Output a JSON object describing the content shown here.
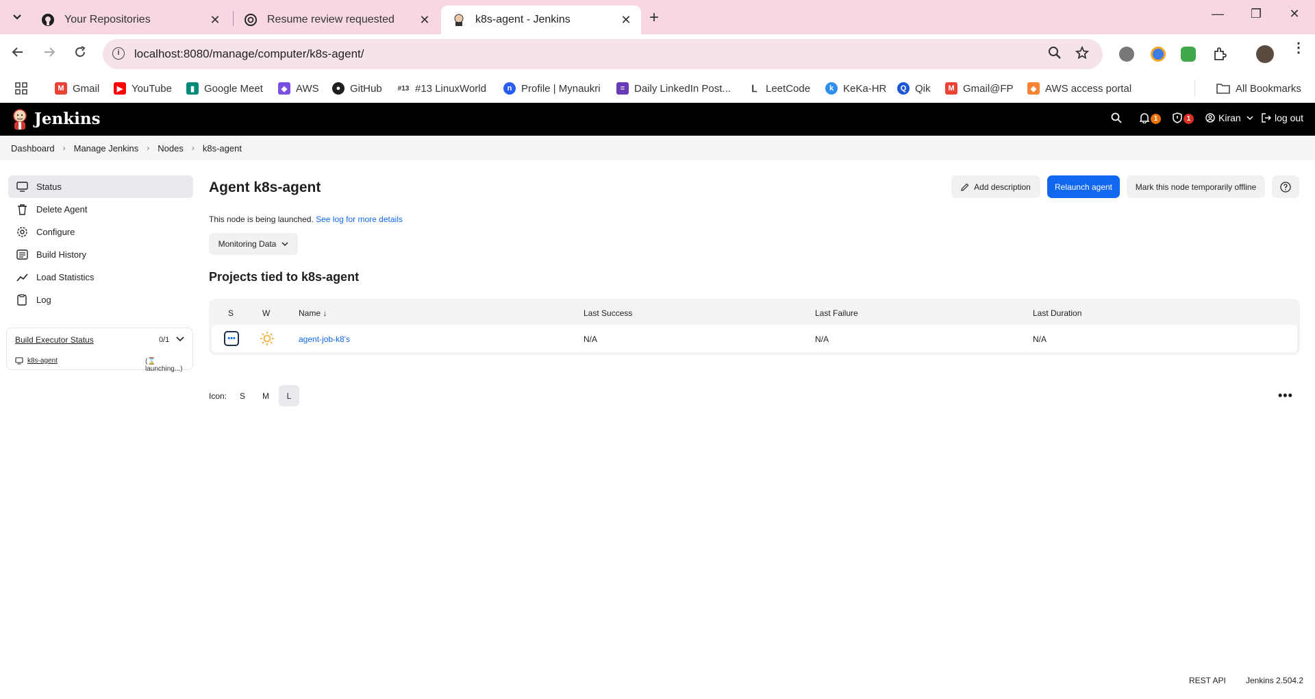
{
  "browser": {
    "tabs": [
      {
        "title": "Your Repositories",
        "icon": "github-icon",
        "active": false
      },
      {
        "title": "Resume review requested",
        "icon": "openai-icon",
        "active": false
      },
      {
        "title": "k8s-agent - Jenkins",
        "icon": "jenkins-icon",
        "active": true
      }
    ],
    "url": "localhost:8080/manage/computer/k8s-agent/",
    "bookmarks": [
      {
        "label": "Gmail",
        "icon": "gmail-icon",
        "color": "#ea4335"
      },
      {
        "label": "YouTube",
        "icon": "youtube-icon",
        "color": "#ff0000"
      },
      {
        "label": "Google Meet",
        "icon": "meet-icon",
        "color": "#00897b"
      },
      {
        "label": "AWS",
        "icon": "aws-icon",
        "color": "#7b4fe0"
      },
      {
        "label": "GitHub",
        "icon": "github-icon",
        "color": "#1f1f1f"
      },
      {
        "label": "#13 LinuxWorld",
        "icon": "linuxworld-icon",
        "color": "#333333"
      },
      {
        "label": "Profile | Mynaukri",
        "icon": "naukri-icon",
        "color": "#275df5"
      },
      {
        "label": "Daily LinkedIn Post...",
        "icon": "forms-icon",
        "color": "#673ab7"
      },
      {
        "label": "LeetCode",
        "icon": "leetcode-icon",
        "color": "#333333"
      },
      {
        "label": "KeKa-HR",
        "icon": "keka-icon",
        "color": "#2f8ff0"
      },
      {
        "label": "Qik",
        "icon": "qik-icon",
        "color": "#1a56d6"
      },
      {
        "label": "Gmail@FP",
        "icon": "gmail-icon",
        "color": "#ea4335"
      },
      {
        "label": "AWS access portal",
        "icon": "aws-portal-icon",
        "color": "#f58534"
      }
    ],
    "all_bookmarks": "All Bookmarks"
  },
  "jenkins": {
    "brand": "Jenkins",
    "user": "Kiran",
    "logout": "log out",
    "notifications_count": "1",
    "security_count": "1",
    "notification_color": "#e8710a",
    "security_color": "#d93025"
  },
  "breadcrumb": [
    "Dashboard",
    "Manage Jenkins",
    "Nodes",
    "k8s-agent"
  ],
  "sidebar": {
    "items": [
      {
        "label": "Status",
        "icon": "monitor-icon"
      },
      {
        "label": "Delete Agent",
        "icon": "trash-icon"
      },
      {
        "label": "Configure",
        "icon": "gear-icon"
      },
      {
        "label": "Build History",
        "icon": "history-icon"
      },
      {
        "label": "Load Statistics",
        "icon": "chart-line-icon"
      },
      {
        "label": "Log",
        "icon": "clipboard-icon"
      }
    ],
    "executor": {
      "title": "Build Executor Status",
      "count": "0/1",
      "node": "k8s-agent",
      "status": "(⌛ launching...)"
    }
  },
  "main": {
    "title": "Agent k8s-agent",
    "add_description": "Add description",
    "relaunch": "Relaunch agent",
    "mark_offline": "Mark this node temporarily offline",
    "launch_message": "This node is being launched.",
    "log_link": "See log for more details",
    "monitoring": "Monitoring Data",
    "projects_title": "Projects tied to k8s-agent",
    "table": {
      "headers": {
        "s": "S",
        "w": "W",
        "name": "Name ↓",
        "last_success": "Last Success",
        "last_failure": "Last Failure",
        "last_duration": "Last Duration"
      },
      "rows": [
        {
          "name": "agent-job-k8's",
          "last_success": "N/A",
          "last_failure": "N/A",
          "last_duration": "N/A"
        }
      ]
    },
    "icon_label": "Icon:",
    "icon_sizes": [
      "S",
      "M",
      "L"
    ],
    "icon_selected": "L"
  },
  "footer": {
    "rest_api": "REST API",
    "version": "Jenkins 2.504.2"
  }
}
